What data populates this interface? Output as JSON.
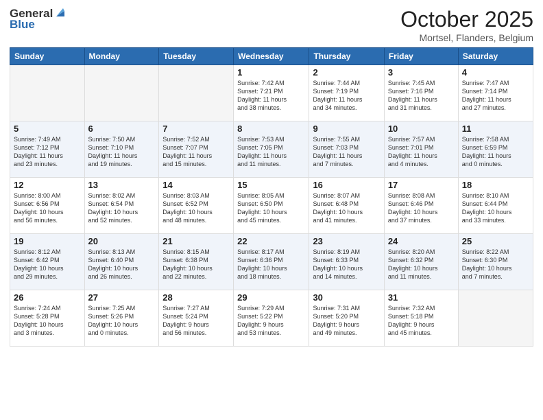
{
  "header": {
    "logo_general": "General",
    "logo_blue": "Blue",
    "month": "October 2025",
    "location": "Mortsel, Flanders, Belgium"
  },
  "weekdays": [
    "Sunday",
    "Monday",
    "Tuesday",
    "Wednesday",
    "Thursday",
    "Friday",
    "Saturday"
  ],
  "weeks": [
    [
      {
        "day": "",
        "info": ""
      },
      {
        "day": "",
        "info": ""
      },
      {
        "day": "",
        "info": ""
      },
      {
        "day": "1",
        "info": "Sunrise: 7:42 AM\nSunset: 7:21 PM\nDaylight: 11 hours\nand 38 minutes."
      },
      {
        "day": "2",
        "info": "Sunrise: 7:44 AM\nSunset: 7:19 PM\nDaylight: 11 hours\nand 34 minutes."
      },
      {
        "day": "3",
        "info": "Sunrise: 7:45 AM\nSunset: 7:16 PM\nDaylight: 11 hours\nand 31 minutes."
      },
      {
        "day": "4",
        "info": "Sunrise: 7:47 AM\nSunset: 7:14 PM\nDaylight: 11 hours\nand 27 minutes."
      }
    ],
    [
      {
        "day": "5",
        "info": "Sunrise: 7:49 AM\nSunset: 7:12 PM\nDaylight: 11 hours\nand 23 minutes."
      },
      {
        "day": "6",
        "info": "Sunrise: 7:50 AM\nSunset: 7:10 PM\nDaylight: 11 hours\nand 19 minutes."
      },
      {
        "day": "7",
        "info": "Sunrise: 7:52 AM\nSunset: 7:07 PM\nDaylight: 11 hours\nand 15 minutes."
      },
      {
        "day": "8",
        "info": "Sunrise: 7:53 AM\nSunset: 7:05 PM\nDaylight: 11 hours\nand 11 minutes."
      },
      {
        "day": "9",
        "info": "Sunrise: 7:55 AM\nSunset: 7:03 PM\nDaylight: 11 hours\nand 7 minutes."
      },
      {
        "day": "10",
        "info": "Sunrise: 7:57 AM\nSunset: 7:01 PM\nDaylight: 11 hours\nand 4 minutes."
      },
      {
        "day": "11",
        "info": "Sunrise: 7:58 AM\nSunset: 6:59 PM\nDaylight: 11 hours\nand 0 minutes."
      }
    ],
    [
      {
        "day": "12",
        "info": "Sunrise: 8:00 AM\nSunset: 6:56 PM\nDaylight: 10 hours\nand 56 minutes."
      },
      {
        "day": "13",
        "info": "Sunrise: 8:02 AM\nSunset: 6:54 PM\nDaylight: 10 hours\nand 52 minutes."
      },
      {
        "day": "14",
        "info": "Sunrise: 8:03 AM\nSunset: 6:52 PM\nDaylight: 10 hours\nand 48 minutes."
      },
      {
        "day": "15",
        "info": "Sunrise: 8:05 AM\nSunset: 6:50 PM\nDaylight: 10 hours\nand 45 minutes."
      },
      {
        "day": "16",
        "info": "Sunrise: 8:07 AM\nSunset: 6:48 PM\nDaylight: 10 hours\nand 41 minutes."
      },
      {
        "day": "17",
        "info": "Sunrise: 8:08 AM\nSunset: 6:46 PM\nDaylight: 10 hours\nand 37 minutes."
      },
      {
        "day": "18",
        "info": "Sunrise: 8:10 AM\nSunset: 6:44 PM\nDaylight: 10 hours\nand 33 minutes."
      }
    ],
    [
      {
        "day": "19",
        "info": "Sunrise: 8:12 AM\nSunset: 6:42 PM\nDaylight: 10 hours\nand 29 minutes."
      },
      {
        "day": "20",
        "info": "Sunrise: 8:13 AM\nSunset: 6:40 PM\nDaylight: 10 hours\nand 26 minutes."
      },
      {
        "day": "21",
        "info": "Sunrise: 8:15 AM\nSunset: 6:38 PM\nDaylight: 10 hours\nand 22 minutes."
      },
      {
        "day": "22",
        "info": "Sunrise: 8:17 AM\nSunset: 6:36 PM\nDaylight: 10 hours\nand 18 minutes."
      },
      {
        "day": "23",
        "info": "Sunrise: 8:19 AM\nSunset: 6:33 PM\nDaylight: 10 hours\nand 14 minutes."
      },
      {
        "day": "24",
        "info": "Sunrise: 8:20 AM\nSunset: 6:32 PM\nDaylight: 10 hours\nand 11 minutes."
      },
      {
        "day": "25",
        "info": "Sunrise: 8:22 AM\nSunset: 6:30 PM\nDaylight: 10 hours\nand 7 minutes."
      }
    ],
    [
      {
        "day": "26",
        "info": "Sunrise: 7:24 AM\nSunset: 5:28 PM\nDaylight: 10 hours\nand 3 minutes."
      },
      {
        "day": "27",
        "info": "Sunrise: 7:25 AM\nSunset: 5:26 PM\nDaylight: 10 hours\nand 0 minutes."
      },
      {
        "day": "28",
        "info": "Sunrise: 7:27 AM\nSunset: 5:24 PM\nDaylight: 9 hours\nand 56 minutes."
      },
      {
        "day": "29",
        "info": "Sunrise: 7:29 AM\nSunset: 5:22 PM\nDaylight: 9 hours\nand 53 minutes."
      },
      {
        "day": "30",
        "info": "Sunrise: 7:31 AM\nSunset: 5:20 PM\nDaylight: 9 hours\nand 49 minutes."
      },
      {
        "day": "31",
        "info": "Sunrise: 7:32 AM\nSunset: 5:18 PM\nDaylight: 9 hours\nand 45 minutes."
      },
      {
        "day": "",
        "info": ""
      }
    ]
  ]
}
